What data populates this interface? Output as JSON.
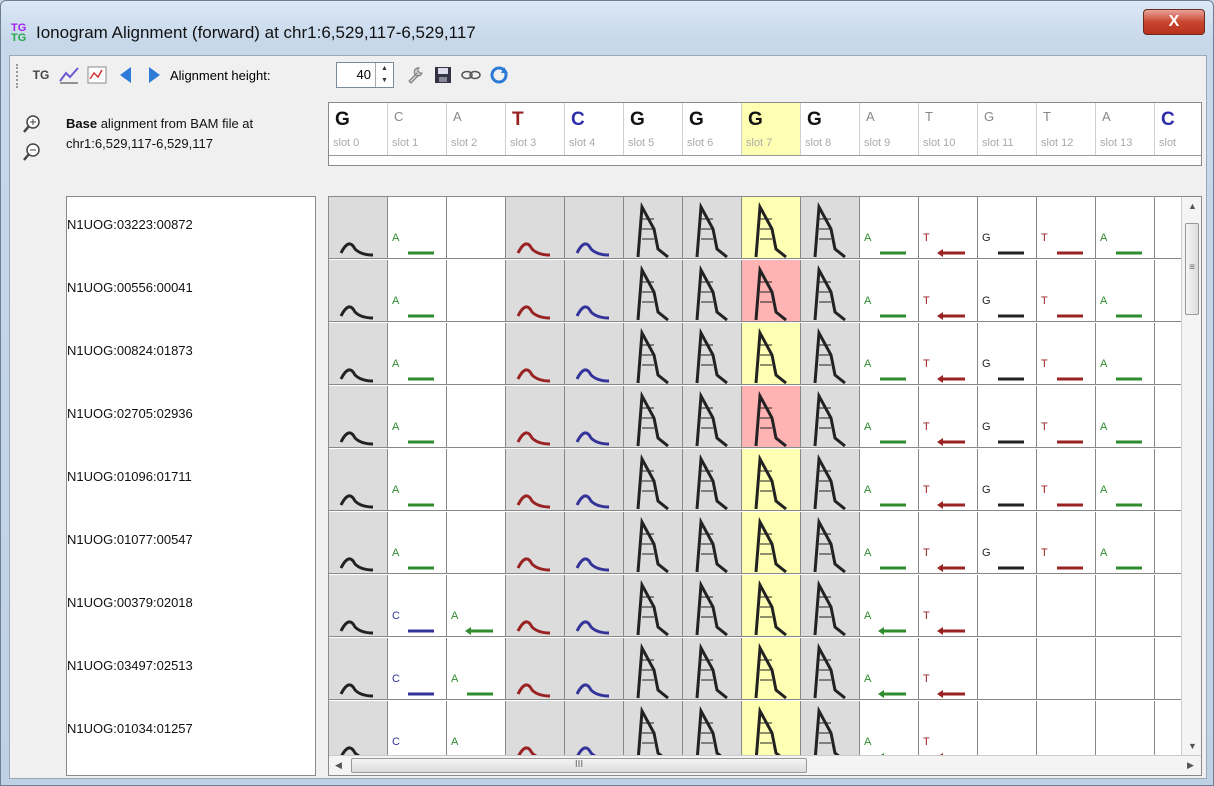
{
  "window": {
    "title": "Ionogram Alignment (forward) at chr1:6,529,117-6,529,117",
    "icon_text_top": "TG",
    "icon_text_bottom": "TG",
    "close_label": "X"
  },
  "toolbar": {
    "tg_label": "TG",
    "alignment_height_label": "Alignment height:",
    "alignment_height_value": "40"
  },
  "info": {
    "bold": "Base",
    "rest": " alignment from BAM file at",
    "location": "chr1:6,529,117-6,529,117"
  },
  "colors": {
    "A": "#2e8b2e",
    "C": "#333399",
    "G": "#222222",
    "T": "#992222",
    "highlight": "#ffffb3",
    "mismatch": "#ffb3b3",
    "shade": "#dcdcdc"
  },
  "slots": [
    {
      "base": "G",
      "label": "slot 0",
      "big": true
    },
    {
      "base": "C",
      "label": "slot 1",
      "big": false
    },
    {
      "base": "A",
      "label": "slot 2",
      "big": false
    },
    {
      "base": "T",
      "label": "slot 3",
      "big": true
    },
    {
      "base": "C",
      "label": "slot 4",
      "big": true
    },
    {
      "base": "G",
      "label": "slot 5",
      "big": true
    },
    {
      "base": "G",
      "label": "slot 6",
      "big": true
    },
    {
      "base": "G",
      "label": "slot 7",
      "big": true
    },
    {
      "base": "G",
      "label": "slot 8",
      "big": true
    },
    {
      "base": "A",
      "label": "slot 9",
      "big": false
    },
    {
      "base": "T",
      "label": "slot 10",
      "big": false
    },
    {
      "base": "G",
      "label": "slot 11",
      "big": false
    },
    {
      "base": "T",
      "label": "slot 12",
      "big": false
    },
    {
      "base": "A",
      "label": "slot 13",
      "big": false
    },
    {
      "base": "C",
      "label": "slot",
      "big": true
    }
  ],
  "reads": [
    {
      "name": "N1UOG:03223:00872",
      "type": "a",
      "mismatch": false
    },
    {
      "name": "N1UOG:00556:00041",
      "type": "a",
      "mismatch": true
    },
    {
      "name": "N1UOG:00824:01873",
      "type": "a",
      "mismatch": false
    },
    {
      "name": "N1UOG:02705:02936",
      "type": "a",
      "mismatch": true
    },
    {
      "name": "N1UOG:01096:01711",
      "type": "a",
      "mismatch": false
    },
    {
      "name": "N1UOG:01077:00547",
      "type": "a",
      "mismatch": false
    },
    {
      "name": "N1UOG:00379:02018",
      "type": "b",
      "mismatch": false
    },
    {
      "name": "N1UOG:03497:02513",
      "type": "b",
      "mismatch": false
    },
    {
      "name": "N1UOG:01034:01257",
      "type": "b",
      "mismatch": false
    }
  ],
  "scroll": {
    "grip_v": "≡",
    "grip_h": "III"
  }
}
